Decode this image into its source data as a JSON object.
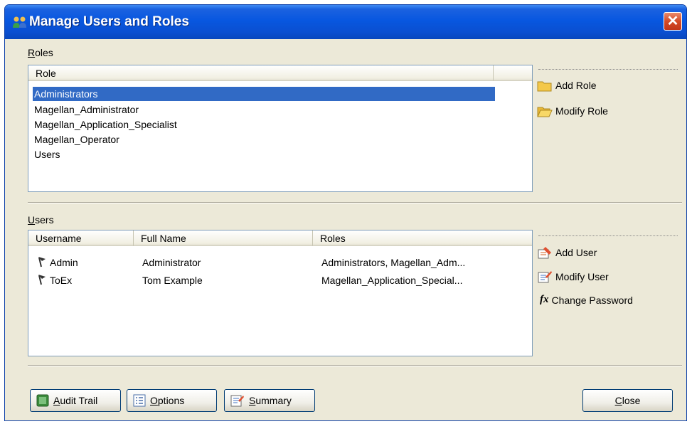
{
  "window": {
    "title": "Manage Users and Roles",
    "close_glyph": "✕"
  },
  "roles": {
    "section_label": "Roles",
    "column_header": "Role",
    "items": [
      "Administrators",
      "Magellan_Administrator",
      "Magellan_Application_Specialist",
      "Magellan_Operator",
      "Users"
    ],
    "selected_index": 0,
    "actions": {
      "add": "Add Role",
      "modify": "Modify Role"
    }
  },
  "users": {
    "section_label": "Users",
    "columns": [
      "Username",
      "Full Name",
      "Roles"
    ],
    "rows": [
      {
        "username": "Admin",
        "full_name": "Administrator",
        "roles": "Administrators, Magellan_Adm..."
      },
      {
        "username": "ToEx",
        "full_name": "Tom Example",
        "roles": "Magellan_Application_Special..."
      }
    ],
    "actions": {
      "add": "Add User",
      "modify": "Modify User",
      "change_password": "Change Password"
    }
  },
  "footer": {
    "audit_trail": "Audit Trail",
    "options": "Options",
    "summary": "Summary",
    "close": "Close"
  },
  "icons": {
    "title": "users-icon",
    "add_role": "folder-icon",
    "modify_role": "open-folder-icon",
    "user_row": "user-flag-icon",
    "add_user": "add-user-icon",
    "modify_user": "edit-icon",
    "change_password": "function-icon",
    "audit_trail": "audit-icon",
    "options": "options-icon",
    "summary": "summary-icon"
  },
  "colors": {
    "titlebar": "#0857e0",
    "selection": "#316ac5",
    "dialog_bg": "#ece9d8"
  }
}
